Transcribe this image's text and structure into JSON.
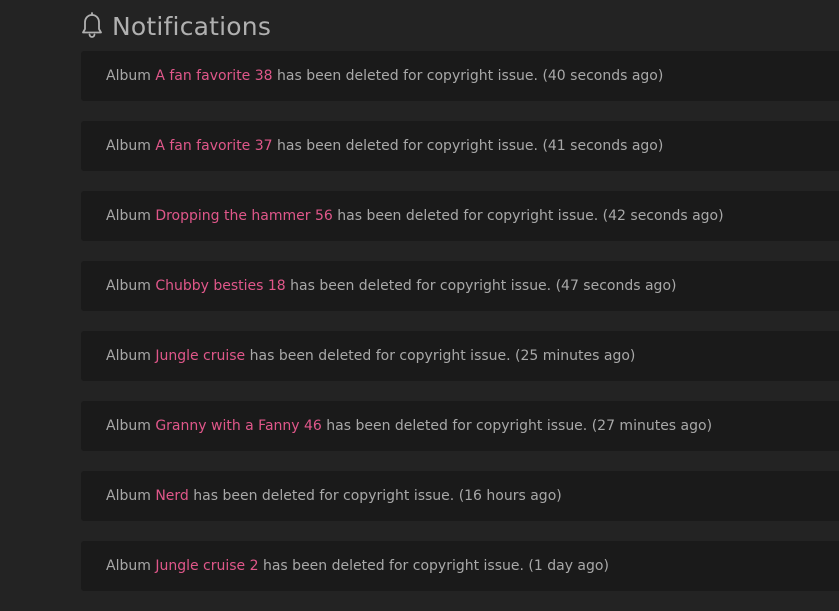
{
  "header": {
    "title": "Notifications",
    "icon": "bell-icon"
  },
  "colors": {
    "background": "#232323",
    "card": "#1a1a1a",
    "link": "#e0578a",
    "text": "#a8a8a8"
  },
  "notifications": [
    {
      "prefix": "Album",
      "album": "A fan favorite 38",
      "message": "has been deleted for copyright issue.",
      "time": "(40 seconds ago)"
    },
    {
      "prefix": "Album",
      "album": "A fan favorite 37",
      "message": "has been deleted for copyright issue.",
      "time": "(41 seconds ago)"
    },
    {
      "prefix": "Album",
      "album": "Dropping the hammer 56",
      "message": "has been deleted for copyright issue.",
      "time": "(42 seconds ago)"
    },
    {
      "prefix": "Album",
      "album": "Chubby besties 18",
      "message": "has been deleted for copyright issue.",
      "time": "(47 seconds ago)"
    },
    {
      "prefix": "Album",
      "album": "Jungle cruise",
      "message": "has been deleted for copyright issue.",
      "time": "(25 minutes ago)"
    },
    {
      "prefix": "Album",
      "album": "Granny with a Fanny 46",
      "message": "has been deleted for copyright issue.",
      "time": "(27 minutes ago)"
    },
    {
      "prefix": "Album",
      "album": "Nerd",
      "message": "has been deleted for copyright issue.",
      "time": "(16 hours ago)"
    },
    {
      "prefix": "Album",
      "album": "Jungle cruise 2",
      "message": "has been deleted for copyright issue.",
      "time": "(1 day ago)"
    }
  ]
}
